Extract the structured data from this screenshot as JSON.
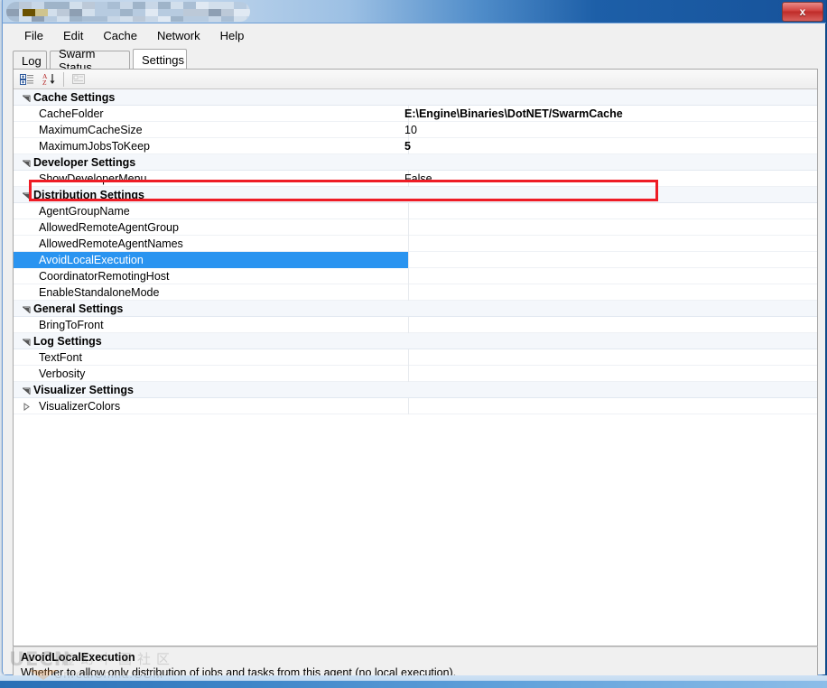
{
  "window": {
    "title": "",
    "title_obscured": true,
    "close_label": "x"
  },
  "menubar": {
    "items": [
      {
        "label": "File"
      },
      {
        "label": "Edit"
      },
      {
        "label": "Cache"
      },
      {
        "label": "Network"
      },
      {
        "label": "Help"
      }
    ]
  },
  "tabs": [
    {
      "label": "Log",
      "active": false
    },
    {
      "label": "Swarm Status",
      "active": false
    },
    {
      "label": "Settings",
      "active": true
    }
  ],
  "grid_toolbar": {
    "buttons": [
      {
        "name": "categorized-view-icon",
        "tooltip": "Categorized"
      },
      {
        "name": "alphabetical-sort-icon",
        "tooltip": "Alphabetical"
      },
      {
        "name": "property-pages-icon",
        "tooltip": "Property Pages",
        "disabled": true
      }
    ]
  },
  "grid": {
    "rows": [
      {
        "kind": "category",
        "name": "Cache Settings",
        "expanded": true
      },
      {
        "kind": "property",
        "name": "CacheFolder",
        "value": "E:\\Engine\\Binaries\\DotNET/SwarmCache",
        "bold": true,
        "highlighted": true
      },
      {
        "kind": "property",
        "name": "MaximumCacheSize",
        "value": "10",
        "bold": false
      },
      {
        "kind": "property",
        "name": "MaximumJobsToKeep",
        "value": "5",
        "bold": true
      },
      {
        "kind": "category",
        "name": "Developer Settings",
        "expanded": true
      },
      {
        "kind": "property",
        "name": "ShowDeveloperMenu",
        "value": "False",
        "bold": false
      },
      {
        "kind": "category",
        "name": "Distribution Settings",
        "expanded": true
      },
      {
        "kind": "property",
        "name": "AgentGroupName",
        "value": "",
        "obscured": true
      },
      {
        "kind": "property",
        "name": "AllowedRemoteAgentGroup",
        "value": "",
        "obscured": true
      },
      {
        "kind": "property",
        "name": "AllowedRemoteAgentNames",
        "value": "",
        "obscured": true
      },
      {
        "kind": "property",
        "name": "AvoidLocalExecution",
        "value": "",
        "obscured": true,
        "selected": true,
        "dropdown": true
      },
      {
        "kind": "property",
        "name": "CoordinatorRemotingHost",
        "value": "",
        "obscured": true
      },
      {
        "kind": "property",
        "name": "EnableStandaloneMode",
        "value": "",
        "obscured": true
      },
      {
        "kind": "category",
        "name": "General Settings",
        "expanded": true
      },
      {
        "kind": "property",
        "name": "BringToFront",
        "value": "",
        "obscured": true
      },
      {
        "kind": "category",
        "name": "Log Settings",
        "expanded": true
      },
      {
        "kind": "property",
        "name": "TextFont",
        "value": "",
        "obscured": true
      },
      {
        "kind": "property",
        "name": "Verbosity",
        "value": "",
        "obscured": true
      },
      {
        "kind": "category",
        "name": "Visualizer Settings",
        "expanded": true
      },
      {
        "kind": "property",
        "name": "VisualizerColors",
        "value": "",
        "obscured": true,
        "expandable": true
      }
    ]
  },
  "description": {
    "title": "AvoidLocalExecution",
    "text": "Whether to allow only distribution of jobs and tasks from this agent (no local execution)."
  },
  "watermark": {
    "logo": "UECN",
    "chinese": "虚幻中国社区",
    "site": "UnrealChina.COM"
  },
  "colors": {
    "selection": "#2a94f0",
    "annotation": "#ee1c25",
    "category_bg": "#f4f7fb",
    "titlebar_blue": "#16529a",
    "close_red": "#bf2b28"
  }
}
